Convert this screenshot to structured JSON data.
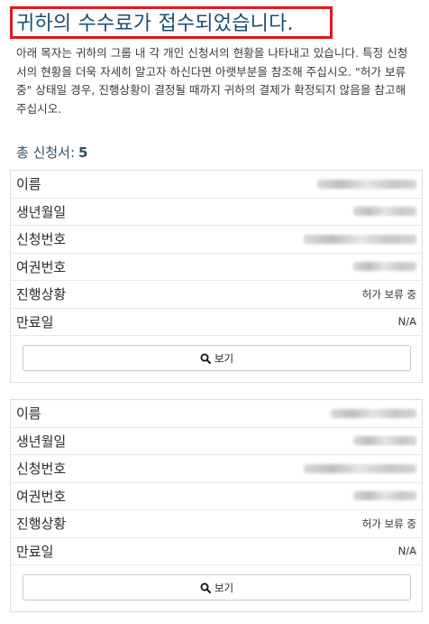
{
  "page": {
    "title": "귀하의 수수료가 접수되었습니다.",
    "intro": "아래 목자는 귀하의 그룹 내 각 개인 신청서의 현황을 나타내고 있습니다. 특정 신청서의 현황을 더욱 자세히 알고자 하신다면 아랫부분을 참조해 주십시오. \"허가 보류 중\" 상태일 경우, 진행상황이 결정될 때까지 귀하의 결제가 확정되지 않음을 참고해 주십시오.",
    "total_label": "총 신청서:",
    "total_count": "5"
  },
  "labels": {
    "name": "이름",
    "dob": "생년월일",
    "application_no": "신청번호",
    "passport_no": "여권번호",
    "status": "진행상황",
    "expiry": "만료일",
    "view_button": "보기"
  },
  "applications": [
    {
      "status": "허가 보류 중",
      "expiry": "N/A"
    },
    {
      "status": "허가 보류 중",
      "expiry": "N/A"
    }
  ],
  "colors": {
    "title": "#1c4f6f",
    "highlight_border": "#e2171c"
  },
  "icons": {
    "view": "search-icon"
  }
}
